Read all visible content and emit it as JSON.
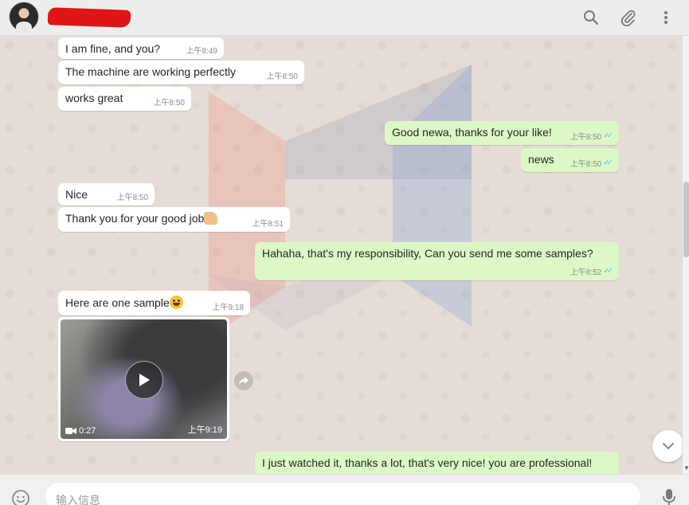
{
  "header": {
    "contact_name": "",
    "icons": [
      "search-icon",
      "attach-icon",
      "menu-icon"
    ]
  },
  "messages": [
    {
      "dir": "in",
      "text": "I am fine, and you?",
      "time": "上午8:49"
    },
    {
      "dir": "in",
      "text": "The machine are working perfectly",
      "time": "上午8:50"
    },
    {
      "dir": "in",
      "text": "works great",
      "time": "上午8:50"
    },
    {
      "dir": "out",
      "text": "Good newa, thanks for your like!",
      "time": "上午8:50",
      "status": "read"
    },
    {
      "dir": "out",
      "text": "news",
      "time": "上午8:50",
      "status": "read"
    },
    {
      "dir": "in",
      "text": "Nice",
      "time": "上午8:50"
    },
    {
      "dir": "in",
      "text": "Thank you for your good job",
      "emoji": "thumbs-up",
      "time": "上午8:51"
    },
    {
      "dir": "out",
      "text": "Hahaha, that's my responsibility, Can you send me some samples?",
      "time": "上午8:52",
      "status": "read"
    },
    {
      "dir": "in",
      "text": "Here are one sample",
      "emoji": "grinning-face",
      "time": "上午9:18"
    },
    {
      "dir": "in",
      "type": "video",
      "duration": "0:27",
      "time": "上午9:19"
    },
    {
      "dir": "out",
      "text": "I just watched it, thanks a lot, that's very nice! you are professional!",
      "time": "",
      "status": ""
    }
  ],
  "composer": {
    "placeholder": "输入信息"
  },
  "colors": {
    "incoming_bubble": "#ffffff",
    "outgoing_bubble": "#dcf8c6",
    "chat_background": "#e5ddd5",
    "read_tick": "#4fc3f7"
  }
}
